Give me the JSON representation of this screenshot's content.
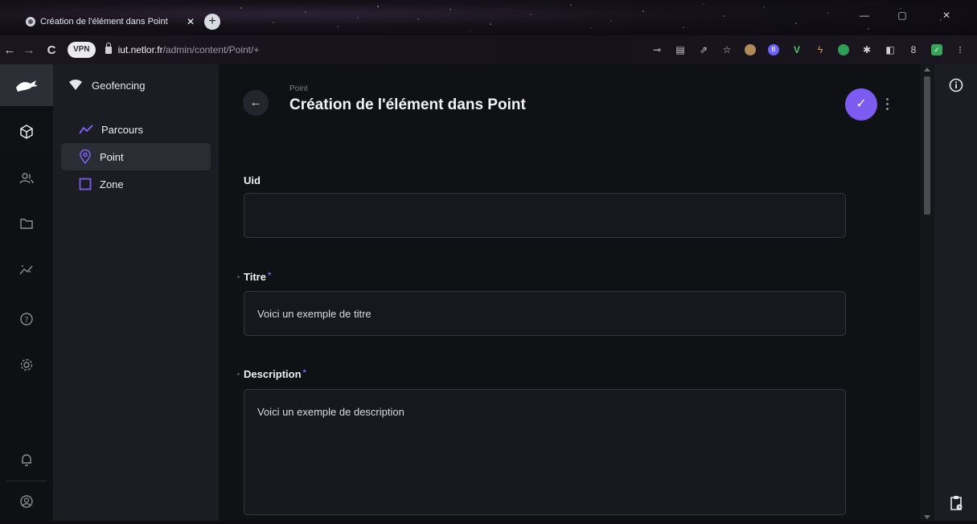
{
  "browser": {
    "tab_title": "Création de l'élément dans Point",
    "tab_close": "✕",
    "new_tab": "+",
    "url_host": "iut.netlor.fr",
    "url_path": "/admin/content/Point/+",
    "vpn_label": "VPN",
    "back": "←",
    "forward": "→",
    "reload": "C",
    "extensions": [
      "key-icon",
      "translate-icon",
      "share-icon",
      "star-icon",
      "avatar-extension-icon",
      "b-extension-icon",
      "v-extension-icon",
      "lightning-extension-icon",
      "shield-extension-icon",
      "puzzle-icon",
      "sidepanel-icon",
      "profile-icon",
      "check-extension-icon",
      "menu-icon"
    ]
  },
  "modules": [
    "content-box-icon",
    "users-icon",
    "folder-icon",
    "insights-icon",
    "help-icon",
    "settings-icon",
    "notifications-icon",
    "account-icon"
  ],
  "nav": {
    "project": "Geofencing",
    "items": [
      {
        "label": "Parcours",
        "icon": "route-icon",
        "active": false
      },
      {
        "label": "Point",
        "icon": "map-pin-icon",
        "active": true
      },
      {
        "label": "Zone",
        "icon": "square-icon",
        "active": false
      }
    ]
  },
  "header": {
    "breadcrumb": "Point",
    "title": "Création de l'élément dans Point",
    "back": "←",
    "save": "✓"
  },
  "form": {
    "uid": {
      "label": "Uid",
      "value": "",
      "required": false
    },
    "titre": {
      "label": "Titre",
      "value": "Voici un exemple de titre",
      "required": true
    },
    "description": {
      "label": "Description",
      "value": "Voici un exemple de description",
      "required": true
    },
    "required_mark": "*"
  },
  "colors": {
    "accent": "#7c5cf0",
    "background": "#101114",
    "nav_bg": "#1b1d22",
    "module_bg": "#0f1014"
  }
}
